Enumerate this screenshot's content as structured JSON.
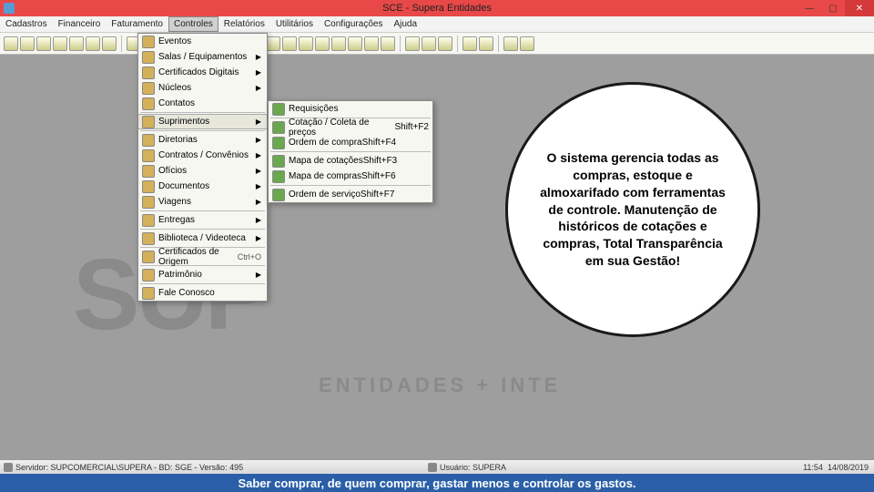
{
  "title": "SCE - Supera Entidades",
  "menubar": [
    "Cadastros",
    "Financeiro",
    "Faturamento",
    "Controles",
    "Relatórios",
    "Utilitários",
    "Configurações",
    "Ajuda"
  ],
  "menubar_active_index": 3,
  "dropdown": [
    {
      "label": "Eventos",
      "arrow": false
    },
    {
      "label": "Salas / Equipamentos",
      "arrow": true
    },
    {
      "label": "Certificados Digitais",
      "arrow": true
    },
    {
      "label": "Núcleos",
      "arrow": true
    },
    {
      "label": "Contatos",
      "arrow": false
    },
    {
      "divider": true
    },
    {
      "label": "Suprimentos",
      "arrow": true,
      "hl": true
    },
    {
      "divider": true
    },
    {
      "label": "Diretorias",
      "arrow": true
    },
    {
      "label": "Contratos / Convênios",
      "arrow": true
    },
    {
      "label": "Ofícios",
      "arrow": true
    },
    {
      "label": "Documentos",
      "arrow": true
    },
    {
      "label": "Viagens",
      "arrow": true
    },
    {
      "divider": true
    },
    {
      "label": "Entregas",
      "arrow": true
    },
    {
      "divider": true
    },
    {
      "label": "Biblioteca / Videoteca",
      "arrow": true
    },
    {
      "divider": true
    },
    {
      "label": "Certificados de Origem",
      "arrow": false,
      "shortcut": "Ctrl+O"
    },
    {
      "divider": true
    },
    {
      "label": "Patrimônio",
      "arrow": true
    },
    {
      "divider": true
    },
    {
      "label": "Fale Conosco",
      "arrow": false
    }
  ],
  "submenu": [
    {
      "label": "Requisições",
      "arrow": false
    },
    {
      "divider": true
    },
    {
      "label": "Cotação / Coleta de preços",
      "shortcut": "Shift+F2"
    },
    {
      "label": "Ordem de compra",
      "shortcut": "Shift+F4"
    },
    {
      "divider": true
    },
    {
      "label": "Mapa de cotações",
      "shortcut": "Shift+F3"
    },
    {
      "label": "Mapa de compras",
      "shortcut": "Shift+F6"
    },
    {
      "divider": true
    },
    {
      "label": "Ordem de serviço",
      "shortcut": "Shift+F7"
    }
  ],
  "callout_text": "O sistema gerencia todas as compras, estoque e almoxarifado com ferramentas de controle. Manutenção de históricos de cotações e compras, Total Transparência em sua Gestão!",
  "status": {
    "server": "Servidor: SUPCOMERCIAL\\SUPERA - BD: SGE - Versão: 495",
    "user": "Usuário: SUPERA",
    "time": "11:54",
    "date": "14/08/2019"
  },
  "caption": "Saber comprar, de quem comprar, gastar menos e controlar os gastos.",
  "watermark": {
    "big": "SUP",
    "sub": "ENTIDADES + INTE"
  }
}
